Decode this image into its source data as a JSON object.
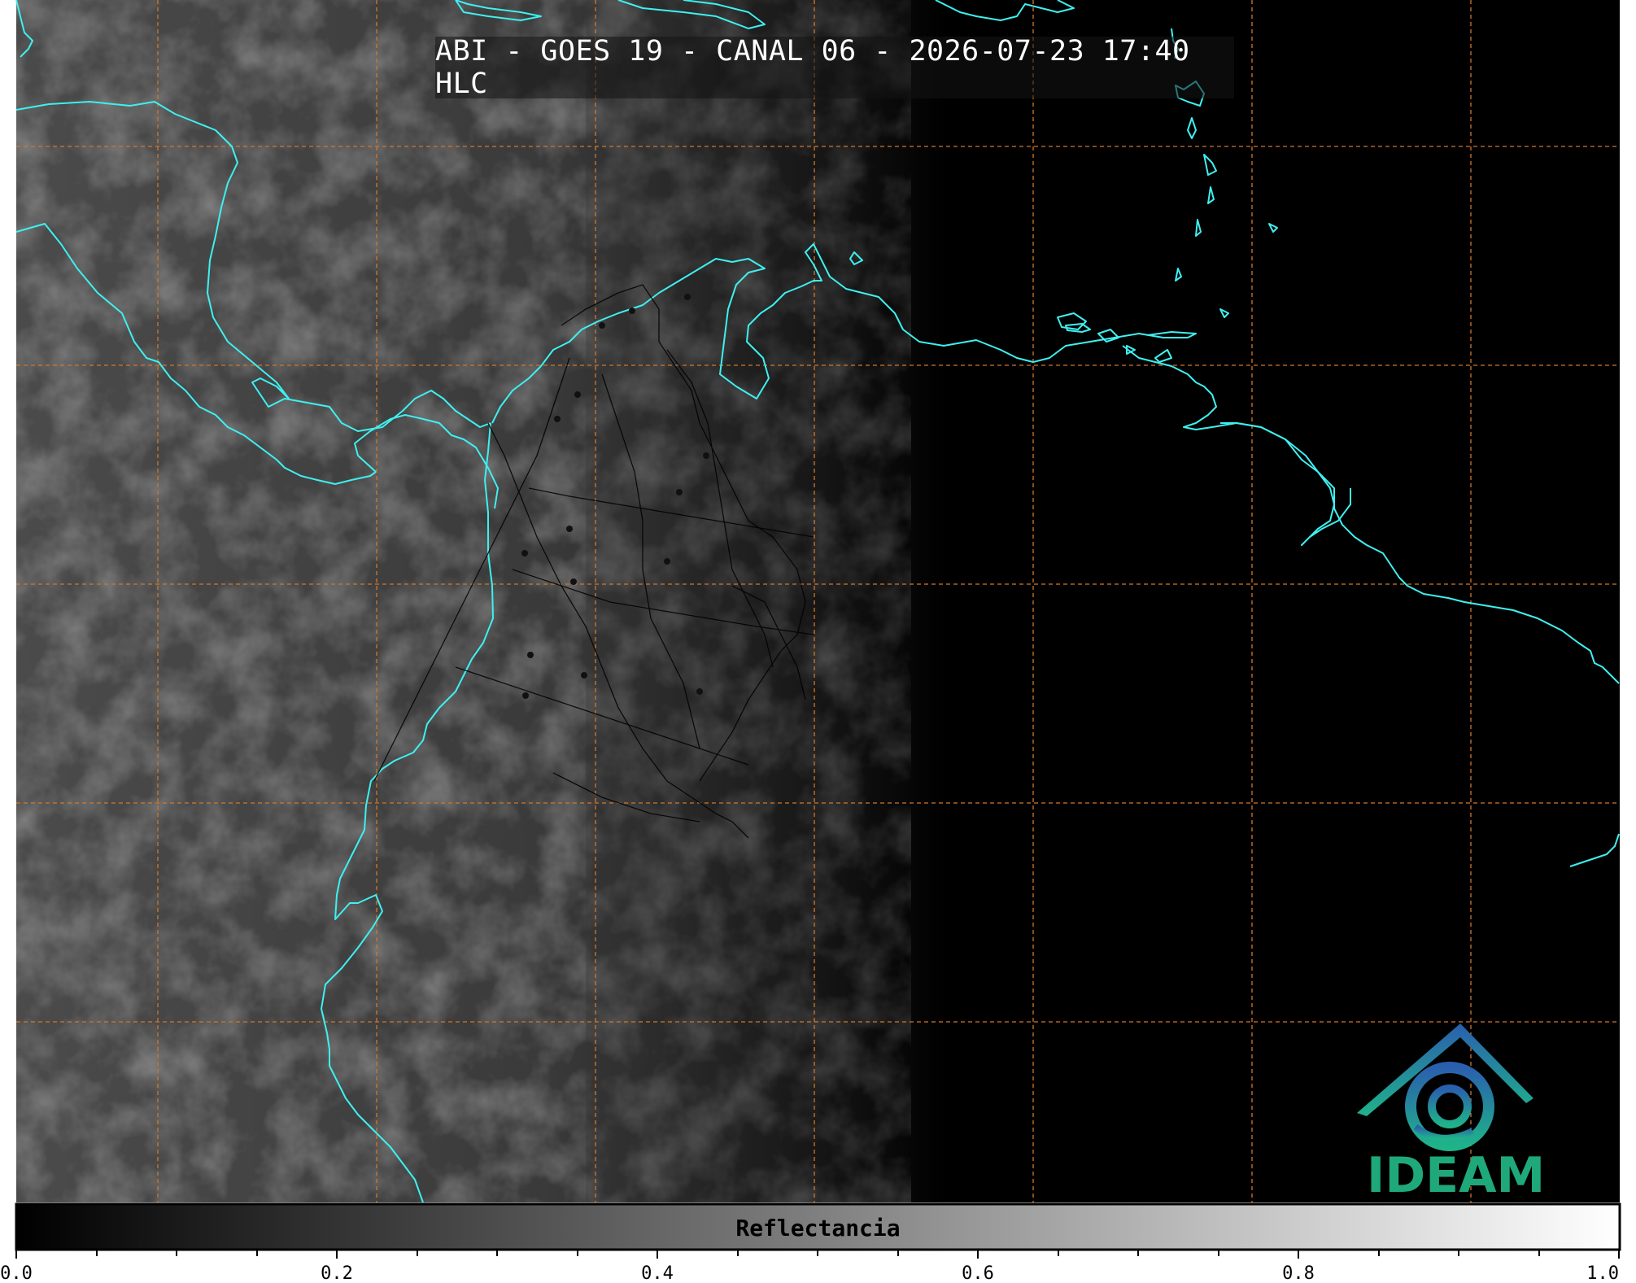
{
  "header": {
    "title": "ABI - GOES 19 - CANAL 06 - 2026-07-23 17:40 HLC"
  },
  "colorbar": {
    "label": "Reflectancia",
    "min": 0.0,
    "max": 1.0,
    "ticks": [
      "0.0",
      "0.2",
      "0.4",
      "0.6",
      "0.8",
      "1.0"
    ],
    "colormap": "gray"
  },
  "logo": {
    "text": "IDEAM",
    "color": "#1fa97a",
    "icon": "ideam-logo-icon"
  },
  "map_style": {
    "coastline_color": "#3ff0f0",
    "border_color": "#000000",
    "graticule_color": "#d2772a",
    "background_color": "#000000"
  }
}
